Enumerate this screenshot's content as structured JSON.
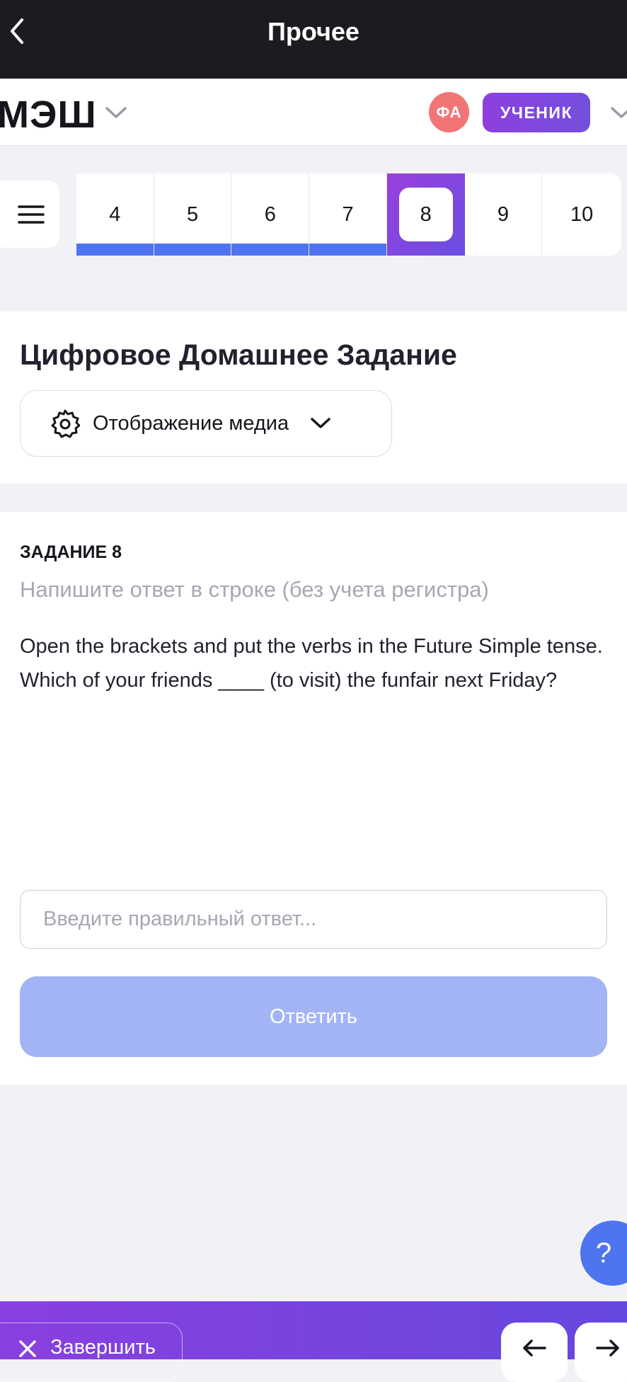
{
  "topbar": {
    "title": "Прочее"
  },
  "header": {
    "logo": "МЭШ",
    "avatar_initials": "ФА",
    "role": "УЧЕНИК"
  },
  "pager": {
    "pages": [
      "4",
      "5",
      "6",
      "7",
      "8",
      "9",
      "10"
    ],
    "answered": [
      "4",
      "5",
      "6",
      "7"
    ],
    "current": "8"
  },
  "card": {
    "title": "Цифровое Домашнее Задание",
    "media_button": "Отображение медиа"
  },
  "task": {
    "number_label": "ЗАДАНИЕ 8",
    "hint": "Напишите ответ в строке (без учета регистра)",
    "text_line1": "Open the brackets and put the verbs in the Future Simple tense.",
    "text_line2": "Which of your friends ____ (to visit) the funfair next Friday?",
    "input_placeholder": "Введите правильный ответ...",
    "input_value": "",
    "submit_label": "Ответить"
  },
  "help": {
    "label": "?"
  },
  "footer": {
    "finish_label": "Завершить"
  },
  "colors": {
    "accent_blue": "#4f74ef",
    "accent_purple": "#8d3fde",
    "submit_disabled": "#a3b4f6",
    "avatar": "#f27575"
  }
}
